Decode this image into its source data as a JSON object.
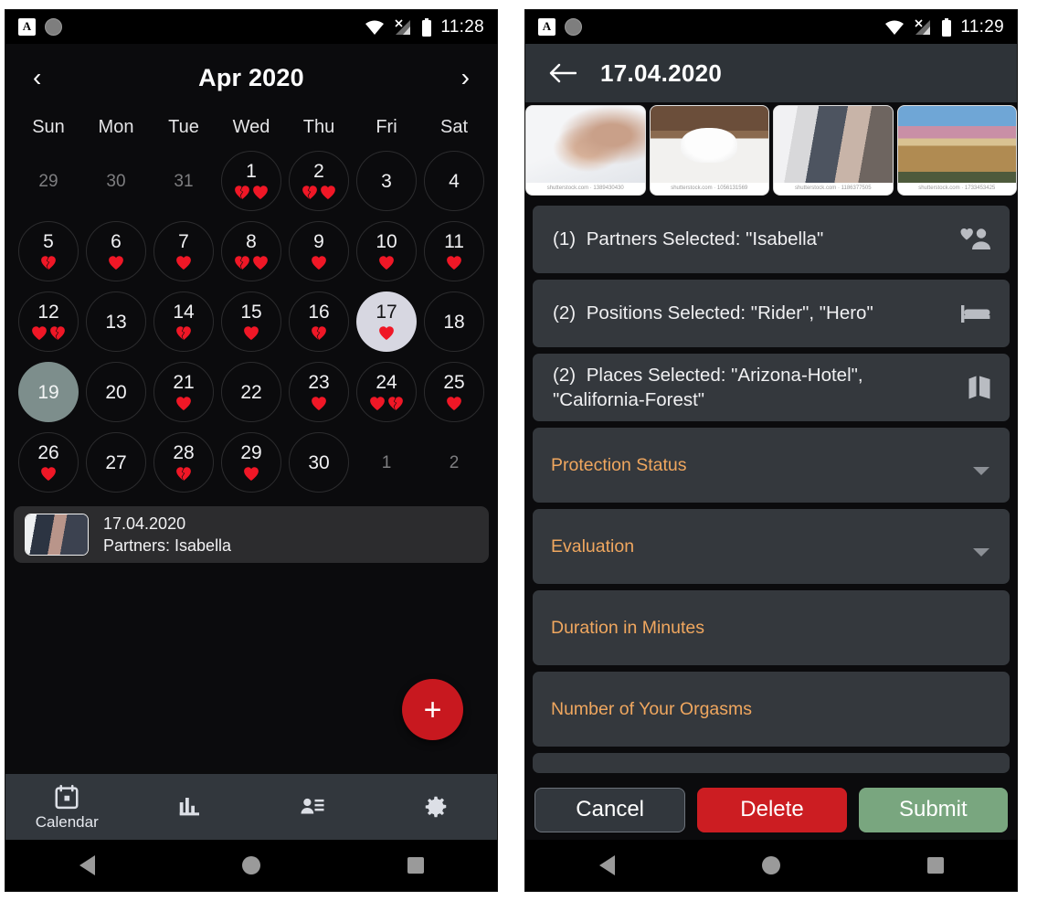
{
  "left": {
    "statusbar": {
      "time": "11:28",
      "icons": [
        "app-a-icon",
        "circle-icon",
        "wifi-icon",
        "cellular-off-icon",
        "battery-icon"
      ]
    },
    "header": {
      "prev": "‹",
      "title": "Apr 2020",
      "next": "›"
    },
    "weekdays": [
      "Sun",
      "Mon",
      "Tue",
      "Wed",
      "Thu",
      "Fri",
      "Sat"
    ],
    "weeks": [
      [
        {
          "n": "29",
          "muted": true,
          "ring": false,
          "hearts": []
        },
        {
          "n": "30",
          "muted": true,
          "ring": false,
          "hearts": []
        },
        {
          "n": "31",
          "muted": true,
          "ring": false,
          "hearts": []
        },
        {
          "n": "1",
          "muted": false,
          "ring": true,
          "hearts": [
            "broken",
            "full"
          ]
        },
        {
          "n": "2",
          "muted": false,
          "ring": true,
          "hearts": [
            "broken",
            "full"
          ]
        },
        {
          "n": "3",
          "muted": false,
          "ring": true,
          "hearts": []
        },
        {
          "n": "4",
          "muted": false,
          "ring": true,
          "hearts": []
        }
      ],
      [
        {
          "n": "5",
          "muted": false,
          "ring": true,
          "hearts": [
            "broken"
          ]
        },
        {
          "n": "6",
          "muted": false,
          "ring": true,
          "hearts": [
            "full"
          ]
        },
        {
          "n": "7",
          "muted": false,
          "ring": true,
          "hearts": [
            "full"
          ]
        },
        {
          "n": "8",
          "muted": false,
          "ring": true,
          "hearts": [
            "broken",
            "full"
          ]
        },
        {
          "n": "9",
          "muted": false,
          "ring": true,
          "hearts": [
            "full"
          ]
        },
        {
          "n": "10",
          "muted": false,
          "ring": true,
          "hearts": [
            "full"
          ]
        },
        {
          "n": "11",
          "muted": false,
          "ring": true,
          "hearts": [
            "full"
          ]
        }
      ],
      [
        {
          "n": "12",
          "muted": false,
          "ring": true,
          "hearts": [
            "full",
            "broken"
          ]
        },
        {
          "n": "13",
          "muted": false,
          "ring": true,
          "hearts": []
        },
        {
          "n": "14",
          "muted": false,
          "ring": true,
          "hearts": [
            "broken"
          ]
        },
        {
          "n": "15",
          "muted": false,
          "ring": true,
          "hearts": [
            "full"
          ]
        },
        {
          "n": "16",
          "muted": false,
          "ring": true,
          "hearts": [
            "broken"
          ]
        },
        {
          "n": "17",
          "muted": false,
          "ring": false,
          "today": true,
          "hearts": [
            "full"
          ]
        },
        {
          "n": "18",
          "muted": false,
          "ring": true,
          "hearts": []
        }
      ],
      [
        {
          "n": "19",
          "muted": false,
          "ring": false,
          "picked": true,
          "hearts": []
        },
        {
          "n": "20",
          "muted": false,
          "ring": true,
          "hearts": []
        },
        {
          "n": "21",
          "muted": false,
          "ring": true,
          "hearts": [
            "full"
          ]
        },
        {
          "n": "22",
          "muted": false,
          "ring": true,
          "hearts": []
        },
        {
          "n": "23",
          "muted": false,
          "ring": true,
          "hearts": [
            "full"
          ]
        },
        {
          "n": "24",
          "muted": false,
          "ring": true,
          "hearts": [
            "full",
            "broken"
          ]
        },
        {
          "n": "25",
          "muted": false,
          "ring": true,
          "hearts": [
            "full"
          ]
        }
      ],
      [
        {
          "n": "26",
          "muted": false,
          "ring": true,
          "hearts": [
            "full"
          ]
        },
        {
          "n": "27",
          "muted": false,
          "ring": true,
          "hearts": []
        },
        {
          "n": "28",
          "muted": false,
          "ring": true,
          "hearts": [
            "broken"
          ]
        },
        {
          "n": "29",
          "muted": false,
          "ring": true,
          "hearts": [
            "full"
          ]
        },
        {
          "n": "30",
          "muted": false,
          "ring": true,
          "hearts": []
        },
        {
          "n": "1",
          "muted": true,
          "ring": false,
          "hearts": []
        },
        {
          "n": "2",
          "muted": true,
          "ring": false,
          "hearts": []
        }
      ]
    ],
    "event_card": {
      "date": "17.04.2020",
      "partners": "Partners:  Isabella",
      "thumb_icon": "event-thumbnail"
    },
    "fab": {
      "label": "+",
      "icon": "plus-icon",
      "color": "#c8181f"
    },
    "bottomnav": [
      {
        "label": "Calendar",
        "icon": "calendar-icon",
        "active": true
      },
      {
        "label": "",
        "icon": "bar-chart-icon",
        "active": false
      },
      {
        "label": "",
        "icon": "contacts-icon",
        "active": false
      },
      {
        "label": "",
        "icon": "gear-icon",
        "active": false
      }
    ]
  },
  "right": {
    "statusbar": {
      "time": "11:29"
    },
    "header": {
      "back": "back-arrow-icon",
      "title": "17.04.2020"
    },
    "thumbnails": [
      {
        "watermark": "shutterstock.com · 1389430430",
        "alt": "hands-on-bed"
      },
      {
        "watermark": "shutterstock.com · 1056131569",
        "alt": "legs-under-blanket"
      },
      {
        "watermark": "shutterstock.com · 1186377505",
        "alt": "two-women-talking"
      },
      {
        "watermark": "shutterstock.com · 1733453425",
        "alt": "city-square-sunset"
      }
    ],
    "selections": [
      {
        "count": "(1)",
        "text": "Partners Selected: \"Isabella\"",
        "icon": "person-heart-icon"
      },
      {
        "count": "(2)",
        "text": "Positions Selected: \"Rider\", \"Hero\"",
        "icon": "bed-icon"
      },
      {
        "count": "(2)",
        "text": "Places Selected: \"Arizona-Hotel\", \"California-Forest\"",
        "icon": "map-icon"
      }
    ],
    "fields": [
      {
        "label": "Protection Status",
        "type": "dropdown"
      },
      {
        "label": "Evaluation",
        "type": "dropdown"
      },
      {
        "label": "Duration in Minutes",
        "type": "text"
      },
      {
        "label": "Number of Your Orgasms",
        "type": "text"
      },
      {
        "label": "",
        "type": "partial"
      }
    ],
    "actions": [
      {
        "label": "Cancel",
        "style": "cancel"
      },
      {
        "label": "Delete",
        "style": "delete"
      },
      {
        "label": "Submit",
        "style": "submit"
      }
    ],
    "accent_color": "#f0a75f"
  }
}
